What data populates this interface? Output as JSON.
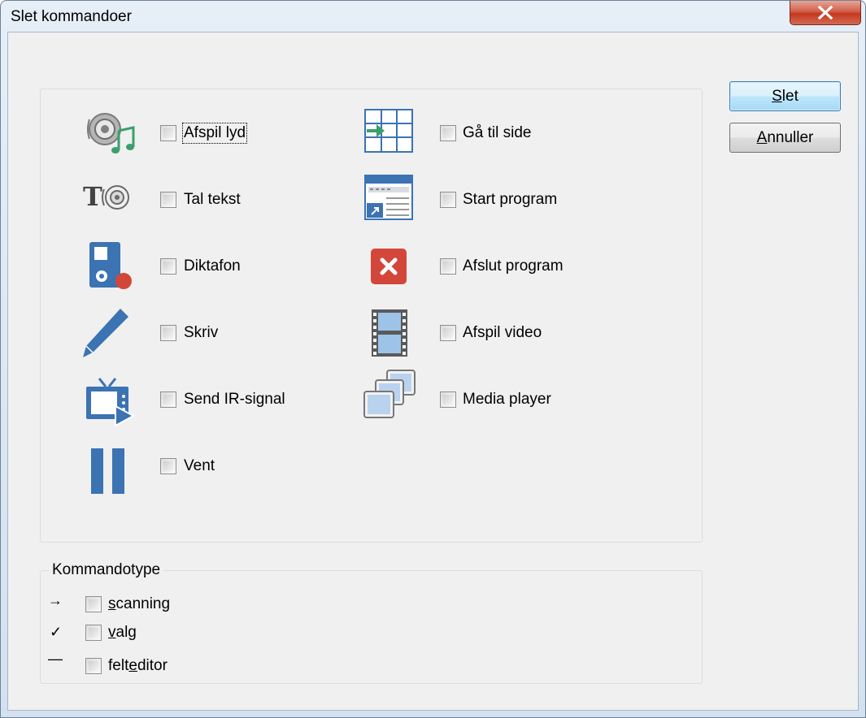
{
  "window": {
    "title": "Slet kommandoer"
  },
  "buttons": {
    "delete": {
      "label": "Slet",
      "accel": "S",
      "rest": "let"
    },
    "cancel": {
      "label": "Annuller",
      "accel": "A",
      "rest": "nnuller"
    }
  },
  "commands": {
    "left": [
      {
        "label": "Afspil lyd",
        "icon": "speaker-music-icon",
        "checked": false
      },
      {
        "label": "Tal tekst",
        "icon": "text-to-speech-icon",
        "checked": false
      },
      {
        "label": "Diktafon",
        "icon": "dictaphone-icon",
        "checked": false
      },
      {
        "label": "Skriv",
        "icon": "pencil-icon",
        "checked": false
      },
      {
        "label": "Send IR-signal",
        "icon": "tv-remote-icon",
        "checked": false
      },
      {
        "label": "Vent",
        "icon": "pause-icon",
        "checked": false
      }
    ],
    "right": [
      {
        "label": "Gå til side",
        "icon": "goto-page-icon",
        "checked": false
      },
      {
        "label": "Start program",
        "icon": "start-program-icon",
        "checked": false
      },
      {
        "label": "Afslut program",
        "icon": "close-program-icon",
        "checked": false
      },
      {
        "label": "Afspil video",
        "icon": "film-icon",
        "checked": false
      },
      {
        "label": "Media player",
        "icon": "media-player-icon",
        "checked": false
      }
    ]
  },
  "command_type": {
    "label": "Kommandotype",
    "items": [
      {
        "label": "scanning",
        "accel": "s",
        "rest": "canning",
        "glyph": "→",
        "checked": false
      },
      {
        "label": "valg",
        "accel": "v",
        "rest": "alg",
        "glyph": "✓",
        "checked": false
      },
      {
        "label": "felteditor",
        "pre": "felt",
        "accel": "e",
        "post": "ditor",
        "glyph": "—",
        "checked": false
      }
    ]
  },
  "colors": {
    "icon_blue": "#3b73b3",
    "icon_green": "#3aa06b",
    "icon_red": "#d3473a",
    "default_button": "#3c7fb1"
  }
}
